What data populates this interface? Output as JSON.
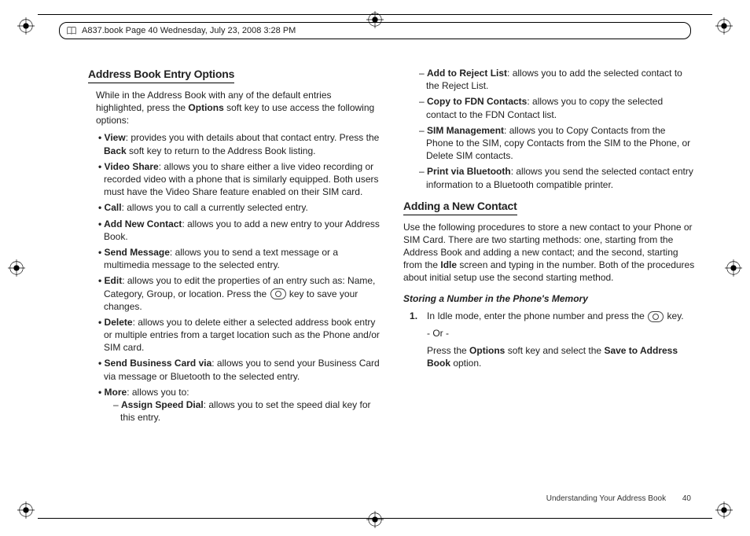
{
  "header": {
    "text": "A837.book  Page 40  Wednesday, July 23, 2008  3:28 PM"
  },
  "section1": {
    "title": "Address Book Entry Options",
    "intro_before_bold": "While in the Address Book with any of the default entries highlighted, press the ",
    "intro_bold": "Options",
    "intro_after_bold": " soft key to use access the following options:",
    "view_label": "View",
    "view_text": ": provides you with details about that contact entry. Press the ",
    "view_bold2": "Back",
    "view_text2": " soft key to return to the Address Book listing.",
    "videoshare_label": "Video Share",
    "videoshare_text": ": allows you to share either a live video recording or recorded video with a phone that is similarly equipped. Both users must have the Video Share feature enabled on their SIM card.",
    "call_label": "Call",
    "call_text": ": allows you to call a currently selected entry.",
    "addnew_label": "Add New Contact",
    "addnew_text": ": allows you to add a new entry to your Address Book.",
    "sendmsg_label": "Send Message",
    "sendmsg_text": ": allows you to send a text message or a multimedia message to the selected entry.",
    "edit_label": "Edit",
    "edit_text": ": allows you to edit the properties of an entry such as: Name, Category, Group, or location. Press the ",
    "edit_text2": " key to save your changes.",
    "delete_label": "Delete",
    "delete_text": ": allows you to delete either a selected address book entry or multiple entries from a target location such as the Phone and/or SIM card.",
    "sendbiz_label": "Send Business Card via",
    "sendbiz_text": ": allows you to send your Business Card via message or Bluetooth to the selected entry.",
    "more_label": "More",
    "more_text": ": allows you to:",
    "assign_label": "Assign Speed Dial",
    "assign_text": ": allows you to set the speed dial key for this entry."
  },
  "col2": {
    "addreject_label": "Add to Reject List",
    "addreject_text": ": allows you to add the selected contact to the Reject List.",
    "copyfdn_label": "Copy to FDN Contacts",
    "copyfdn_text": ": allows you to copy the selected contact to the FDN Contact list.",
    "sim_label": "SIM Management",
    "sim_text": ": allows you to Copy Contacts from the Phone to the SIM, copy Contacts from the SIM to the Phone, or Delete SIM contacts.",
    "print_label": "Print via Bluetooth",
    "print_text": ": allows you send the selected contact entry information to a Bluetooth compatible printer."
  },
  "section2": {
    "title": "Adding a New Contact",
    "intro_a": "Use the following procedures to store a new contact to your Phone or SIM Card. There are two starting methods: one, starting from the Address Book and adding a new contact; and the second, starting from the ",
    "intro_bold": "Idle",
    "intro_b": " screen and typing in the number. Both of the procedures about initial setup use the second starting method.",
    "subheading": "Storing a Number in the Phone's Memory",
    "step1_a": "In Idle mode, enter the phone number and press the ",
    "step1_b": " key.",
    "or_text": "- Or -",
    "step1_c_a": "Press the ",
    "step1_c_bold1": "Options",
    "step1_c_mid": " soft key and select the ",
    "step1_c_bold2": "Save to Address Book",
    "step1_c_end": " option."
  },
  "footer": {
    "section": "Understanding Your Address Book",
    "page": "40"
  }
}
